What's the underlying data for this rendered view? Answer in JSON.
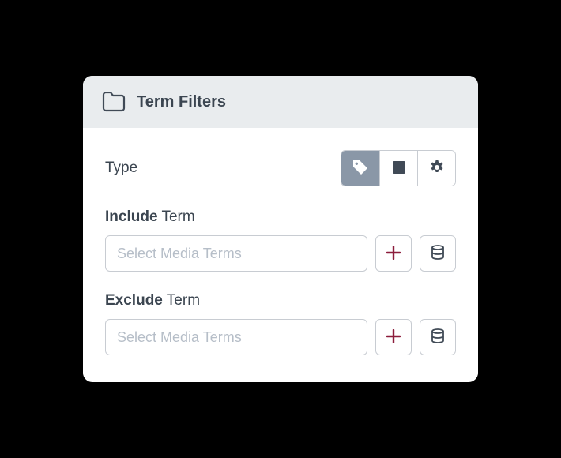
{
  "header": {
    "title": "Term Filters",
    "icon": "folder-icon"
  },
  "type": {
    "label": "Type",
    "options": [
      {
        "icon": "tag-icon",
        "active": true
      },
      {
        "icon": "square-icon",
        "active": false
      },
      {
        "icon": "gear-icon",
        "active": false
      }
    ]
  },
  "include": {
    "label_strong": "Include",
    "label_rest": " Term",
    "placeholder": "Select Media Terms",
    "add_icon": "plus-icon",
    "db_icon": "database-icon"
  },
  "exclude": {
    "label_strong": "Exclude",
    "label_rest": " Term",
    "placeholder": "Select Media Terms",
    "add_icon": "plus-icon",
    "db_icon": "database-icon"
  },
  "colors": {
    "accent": "#8c1d3c",
    "icon_gray": "#404a56",
    "seg_active_bg": "#8a97a7"
  }
}
